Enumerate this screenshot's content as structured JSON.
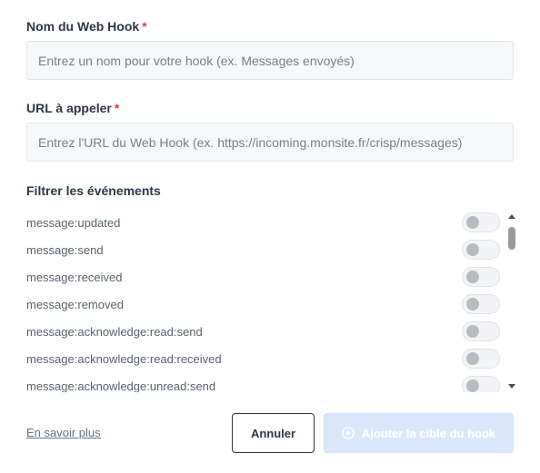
{
  "form": {
    "name_label": "Nom du Web Hook",
    "name_required": "*",
    "name_placeholder": "Entrez un nom pour votre hook (ex. Messages envoyés)",
    "url_label": "URL à appeler",
    "url_required": "*",
    "url_placeholder": "Entrez l'URL du Web Hook (ex. https://incoming.monsite.fr/crisp/messages)"
  },
  "events": {
    "title": "Filtrer les événements",
    "items": [
      {
        "name": "message:updated",
        "enabled": false
      },
      {
        "name": "message:send",
        "enabled": false
      },
      {
        "name": "message:received",
        "enabled": false
      },
      {
        "name": "message:removed",
        "enabled": false
      },
      {
        "name": "message:acknowledge:read:send",
        "enabled": false
      },
      {
        "name": "message:acknowledge:read:received",
        "enabled": false
      },
      {
        "name": "message:acknowledge:unread:send",
        "enabled": false
      }
    ]
  },
  "footer": {
    "learn_more": "En savoir plus",
    "cancel": "Annuler",
    "add_target": "Ajouter la cible du hook"
  },
  "colors": {
    "required": "#e53e3e",
    "primary_disabled": "#dbe8fc"
  }
}
